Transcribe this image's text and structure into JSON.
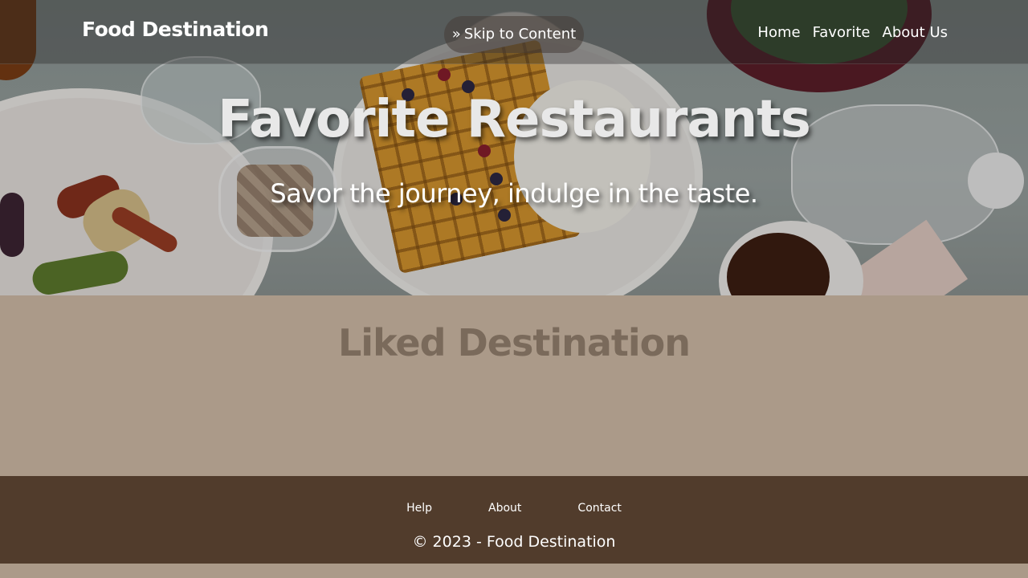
{
  "header": {
    "brand": "Food Destination",
    "skip_link": "Skip to Content",
    "skip_icon": "double-chevron-right-icon",
    "nav": [
      {
        "label": "Home"
      },
      {
        "label": "Favorite"
      },
      {
        "label": "About Us"
      }
    ]
  },
  "hero": {
    "title": "Favorite Restaurants",
    "subtitle": "Savor the journey, indulge in the taste."
  },
  "main": {
    "title": "Liked Destination"
  },
  "footer": {
    "links": [
      {
        "label": "Help"
      },
      {
        "label": "About"
      },
      {
        "label": "Contact"
      }
    ],
    "copyright": "© 2023 - Food Destination"
  },
  "colors": {
    "page_bg": "#ab9a89",
    "footer_bg": "#513c2c",
    "main_title": "#7a6a5b",
    "text_light": "#ffffff"
  }
}
